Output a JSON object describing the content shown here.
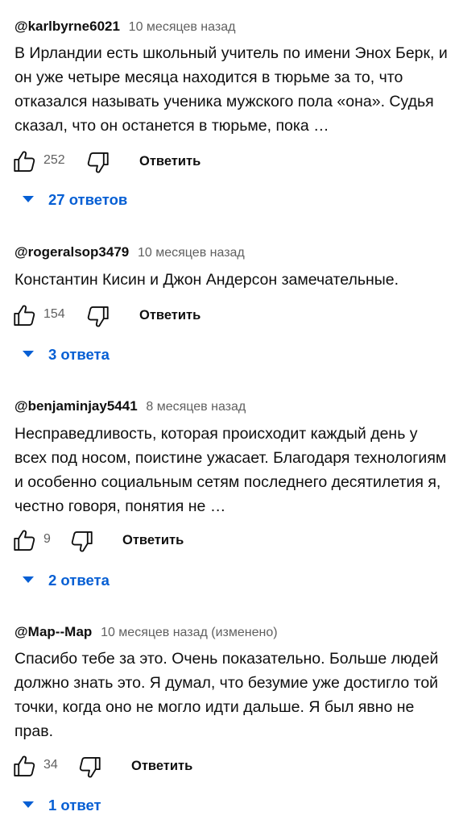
{
  "reply_label": "Ответить",
  "colors": {
    "accent": "#065fd4",
    "meta": "#606060",
    "text": "#0f0f0f"
  },
  "comments": [
    {
      "author": "@karlbyrne6021",
      "time": "10 месяцев назад",
      "text": "В Ирландии есть школьный учитель по имени Энох Берк, и он уже четыре месяца находится в тюрьме за то, что отказался называть ученика мужского пола «она». Судья сказал, что он останется в тюрьме, пока …",
      "likes": "252",
      "replies": "27 ответов"
    },
    {
      "author": "@rogeralsop3479",
      "time": "10 месяцев назад",
      "text": "Константин Кисин и Джон Андерсон замечательные.",
      "likes": "154",
      "replies": "3 ответа"
    },
    {
      "author": "@benjaminjay5441",
      "time": "8 месяцев назад",
      "text": "Несправедливость, которая происходит каждый день у всех под носом, поистине ужасает. Благодаря технологиям и особенно социальным сетям последнего десятилетия я, честно говоря, понятия не …",
      "likes": "9",
      "replies": "2 ответа"
    },
    {
      "author": "@Мар--Мар",
      "time": "10 месяцев назад (изменено)",
      "text": "Спасибо тебе за это. Очень показательно. Больше людей должно знать это. Я думал, что безумие уже достигло той точки, когда оно не могло идти дальше. Я был явно не прав.",
      "likes": "34",
      "replies": "1 ответ"
    }
  ]
}
